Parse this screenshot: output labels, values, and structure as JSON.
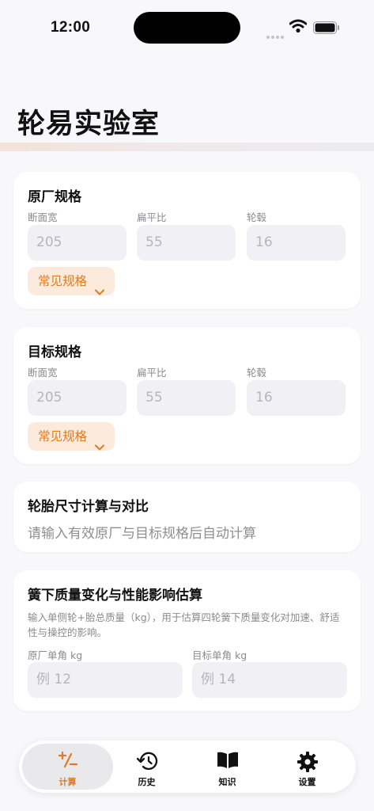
{
  "status_bar": {
    "time": "12:00"
  },
  "page_title": "轮易实验室",
  "original_spec": {
    "title": "原厂规格",
    "fields": [
      {
        "label": "断面宽",
        "placeholder": "205"
      },
      {
        "label": "扁平比",
        "placeholder": "55"
      },
      {
        "label": "轮毂",
        "placeholder": "16"
      }
    ],
    "preset_label": "常见规格"
  },
  "target_spec": {
    "title": "目标规格",
    "fields": [
      {
        "label": "断面宽",
        "placeholder": "205"
      },
      {
        "label": "扁平比",
        "placeholder": "55"
      },
      {
        "label": "轮毂",
        "placeholder": "16"
      }
    ],
    "preset_label": "常见规格"
  },
  "size_compare": {
    "title": "轮胎尺寸计算与对比",
    "hint": "请输入有效原厂与目标规格后自动计算"
  },
  "unsprung": {
    "title": "簧下质量变化与性能影响估算",
    "description": "输入单侧轮+胎总质量（kg），用于估算四轮簧下质量变化对加速、舒适性与操控的影响。",
    "original_label": "原厂单角 kg",
    "original_placeholder": "例 12",
    "target_label": "目标单角 kg",
    "target_placeholder": "例 14"
  },
  "tabs": [
    {
      "label": "计算",
      "icon": "calculate-icon",
      "active": true
    },
    {
      "label": "历史",
      "icon": "history-icon",
      "active": false
    },
    {
      "label": "知识",
      "icon": "book-icon",
      "active": false
    },
    {
      "label": "设置",
      "icon": "gear-icon",
      "active": false
    }
  ],
  "colors": {
    "accent": "#e07a1f",
    "accent_bg": "#fcebdc",
    "input_bg": "#f1f1f5",
    "background": "#f8f8fa"
  }
}
